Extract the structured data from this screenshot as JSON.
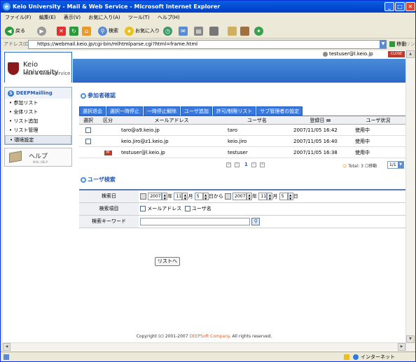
{
  "window": {
    "title": "Keio University - Mail & Web Service - Microsoft Internet Explorer"
  },
  "menu": [
    "ファイル(F)",
    "編集(E)",
    "表示(V)",
    "お気に入り(A)",
    "ツール(T)",
    "ヘルプ(H)"
  ],
  "toolbar": {
    "back": "戻る",
    "search": "検索",
    "favorites": "お気に入り"
  },
  "address": {
    "label": "アドレス(D)",
    "url": "https://webmail.keio.jp/cgi-bin/mlhtmlparse.cgi?html=frame.html",
    "go": "移動",
    "links": "リンク"
  },
  "header": {
    "title": "Keio University",
    "subtitle": "Mail & Web Service",
    "user": "testuser@l.keio.jp",
    "close": "CLOSE"
  },
  "sidebar": {
    "title": "DEEPMailling",
    "items": [
      "参加リスト",
      "全体リスト",
      "リスト追加",
      "リスト管理",
      "環境設定"
    ],
    "help_title": "ヘルプ",
    "help_sub": "MAIL HELP"
  },
  "participants": {
    "title": "参加者確認",
    "buttons": [
      "選択退会",
      "選択一時停止",
      "一時停止解除",
      "ユーザ追加",
      "許可/制限リスト",
      "サブ管理者の設定"
    ],
    "columns": [
      "選択",
      "区分",
      "メールアドレス",
      "ユーザ名",
      "登録日",
      "ユーザ状況"
    ],
    "rows": [
      {
        "email": "taro@a9.keio.jp",
        "name": "taro",
        "date": "2007/11/05 16:42",
        "status": "使用中",
        "tag": ""
      },
      {
        "email": "keio.jiro@z1.keio.jp",
        "name": "keio.jiro",
        "date": "2007/11/05 16:40",
        "status": "使用中",
        "tag": ""
      },
      {
        "email": "testuser@l.keio.jp",
        "name": "testuser",
        "date": "2007/11/05 16:38",
        "status": "使用中",
        "tag": "M"
      }
    ],
    "page": "1",
    "total": "Total: 3",
    "move": "移動",
    "page_select": "1/1"
  },
  "search": {
    "title": "ユーザ検索",
    "date_label": "検索日",
    "from": {
      "year": "2007",
      "month": "11",
      "day": "5"
    },
    "to": {
      "year": "2007",
      "month": "11",
      "day": "5"
    },
    "unit_year": "年",
    "unit_month": "月",
    "from_suffix": "日から",
    "unit_day": "日",
    "item_label": "検索項目",
    "opt_mail": "メールアドレス",
    "opt_user": "ユーザ名",
    "keyword_label": "検索キーワード",
    "list_button": "リストへ"
  },
  "footer": {
    "pre": "Copyright (c) 2001-2007 ",
    "company": "DEEPSoft Company",
    "post": ". All rights reserved."
  },
  "status": {
    "zone": "インターネット"
  }
}
